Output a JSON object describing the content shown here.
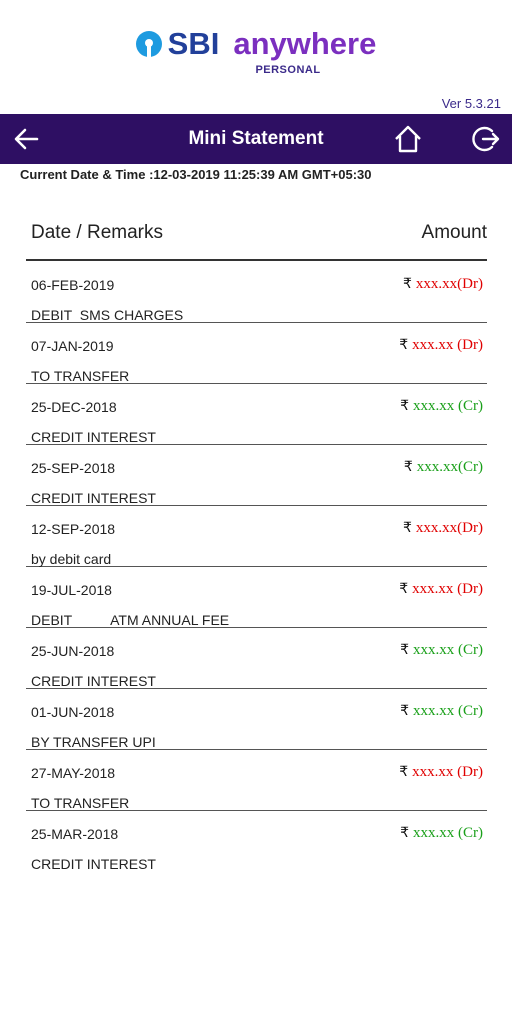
{
  "app": {
    "logo_brand": "SBI",
    "logo_product": "anywhere",
    "logo_sub": "PERSONAL",
    "version": "Ver 5.3.21"
  },
  "header": {
    "title": "Mini Statement",
    "back_icon": "arrow-left-icon",
    "home_icon": "home-icon",
    "logout_icon": "logout-icon"
  },
  "datetime": "Current Date & Time :12-03-2019 11:25:39 AM GMT+05:30",
  "table": {
    "col_left": "Date / Remarks",
    "col_right": "Amount",
    "rupee_symbol": "₹",
    "rows": [
      {
        "date": "06-FEB-2019",
        "remark": "DEBIT  SMS CHARGES",
        "amount": "xxx.xx(Dr)",
        "type": "dr"
      },
      {
        "date": "07-JAN-2019",
        "remark": "TO TRANSFER",
        "amount": "xxx.xx (Dr)",
        "type": "dr"
      },
      {
        "date": "25-DEC-2018",
        "remark": "CREDIT INTEREST",
        "amount": "xxx.xx (Cr)",
        "type": "cr"
      },
      {
        "date": "25-SEP-2018",
        "remark": "CREDIT INTEREST",
        "amount": "xxx.xx(Cr)",
        "type": "cr"
      },
      {
        "date": "12-SEP-2018",
        "remark": "by debit card",
        "amount": "xxx.xx(Dr)",
        "type": "dr"
      },
      {
        "date": "19-JUL-2018",
        "remark": "DEBIT          ATM ANNUAL FEE",
        "amount": "xxx.xx (Dr)",
        "type": "dr"
      },
      {
        "date": "25-JUN-2018",
        "remark": "CREDIT INTEREST",
        "amount": "xxx.xx (Cr)",
        "type": "cr"
      },
      {
        "date": "01-JUN-2018",
        "remark": "BY TRANSFER UPI",
        "amount": "xxx.xx (Cr)",
        "type": "cr"
      },
      {
        "date": "27-MAY-2018",
        "remark": "TO TRANSFER",
        "amount": "xxx.xx (Dr)",
        "type": "dr"
      },
      {
        "date": "25-MAR-2018",
        "remark": "CREDIT INTEREST",
        "amount": "xxx.xx (Cr)",
        "type": "cr"
      }
    ]
  },
  "colors": {
    "brand_blue": "#22409a",
    "brand_purple": "#7b2fbf",
    "header_bg": "#2e0f63",
    "debit": "#e00000",
    "credit": "#1aa01a"
  }
}
